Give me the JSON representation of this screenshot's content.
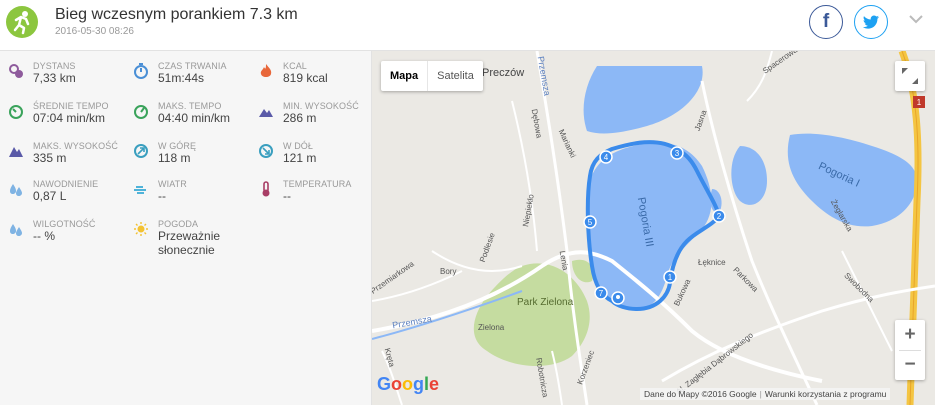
{
  "activity": {
    "title": "Bieg wczesnym porankiem 7.3 km",
    "date": "2016-05-30 08:26",
    "icon": "running-person-icon",
    "accent": "#8cc63f"
  },
  "share": {
    "facebook_label": "f",
    "facebook_color": "#3b5998",
    "twitter_color": "#1da1f2"
  },
  "stats": [
    {
      "label": "DYSTANS",
      "value": "7,33 km",
      "icon": "distance-pin-icon",
      "color": "#8e5b9c"
    },
    {
      "label": "CZAS TRWANIA",
      "value": "51m:44s",
      "icon": "stopwatch-icon",
      "color": "#4a8fd6"
    },
    {
      "label": "KCAL",
      "value": "819 kcal",
      "icon": "flame-icon",
      "color": "#e8673a"
    },
    {
      "label": "ŚREDNIE TEMPO",
      "value": "07:04 min/km",
      "icon": "speedometer-icon",
      "color": "#3aa35b"
    },
    {
      "label": "MAKS. TEMPO",
      "value": "04:40 min/km",
      "icon": "speedometer-max-icon",
      "color": "#3aa35b"
    },
    {
      "label": "MIN. WYSOKOŚĆ",
      "value": "286 m",
      "icon": "mountain-min-icon",
      "color": "#5a5aa8"
    },
    {
      "label": "MAKS. WYSOKOŚĆ",
      "value": "335 m",
      "icon": "mountain-max-icon",
      "color": "#5a5aa8"
    },
    {
      "label": "W GÓRĘ",
      "value": "118 m",
      "icon": "ascent-icon",
      "color": "#3a9fbf"
    },
    {
      "label": "W DÓŁ",
      "value": "121 m",
      "icon": "descent-icon",
      "color": "#3a9fbf"
    },
    {
      "label": "NAWODNIENIE",
      "value": "0,87 L",
      "icon": "water-drop-icon",
      "color": "#7fb3e3"
    },
    {
      "label": "WIATR",
      "value": "--",
      "icon": "wind-icon",
      "color": "#4fb3d9"
    },
    {
      "label": "TEMPERATURA",
      "value": "--",
      "icon": "thermometer-icon",
      "color": "#a83e66"
    },
    {
      "label": "WILGOTNOŚĆ",
      "value": "-- %",
      "icon": "humidity-drops-icon",
      "color": "#7fb3e3"
    },
    {
      "label": "POGODA",
      "value": "Przeważnie słonecznie",
      "icon": "sun-icon",
      "color": "#f3c232"
    }
  ],
  "map": {
    "type_map": "Mapa",
    "type_satellite": "Satelita",
    "zoom_in": "+",
    "zoom_out": "−",
    "attribution": "Dane do Mapy ©2016 Google",
    "terms": "Warunki korzystania z programu",
    "route_color": "#3b8beb",
    "water_color": "#8cb8f6",
    "park_color": "#c5dca0",
    "labels": {
      "preczow": "Preczów",
      "pogoria3": "Pogoria III",
      "pogoria1": "Pogoria I",
      "park": "Park Zielona",
      "zielona": "Zielona",
      "bory": "Bory",
      "przemsza": "Przemsza",
      "przemsza2": "Przemsza",
      "przemiarkowa": "Przemiarkowa",
      "podlesie": "Podlesie",
      "lenia": "Lenia",
      "niepiekło": "Niepiekło",
      "dobrowa": "Dębowa",
      "marianki": "Marianki",
      "jasna": "Jasna",
      "spacerowa": "Spacerowa",
      "leknice": "Łęknice",
      "bukowa": "Bukowa",
      "parkowa": "Parkowa",
      "swobodna": "Swobodna",
      "zeglarska": "Żeglarska",
      "zaglebia": "Al. Zagłębia Dąbrowskiego",
      "korzeniec": "Korzeniec",
      "robotnicza": "Robotnicza",
      "kreta": "Kręta",
      "road1": "1"
    },
    "markers": [
      "1",
      "2",
      "3",
      "4",
      "5",
      "7"
    ],
    "google": [
      "G",
      "o",
      "o",
      "g",
      "l",
      "e"
    ]
  }
}
